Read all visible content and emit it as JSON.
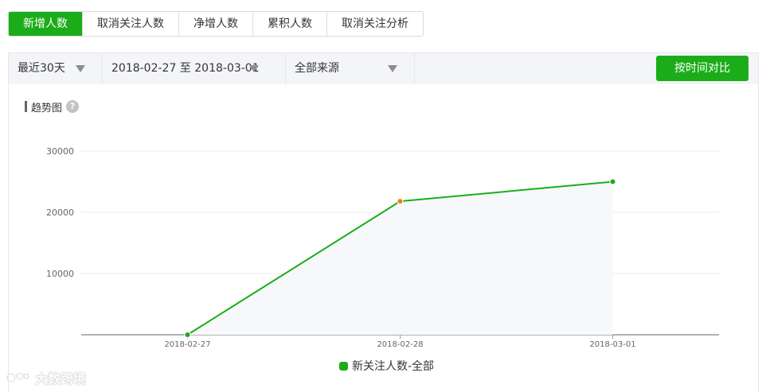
{
  "tabs": [
    {
      "label": "新增人数",
      "active": true
    },
    {
      "label": "取消关注人数",
      "active": false
    },
    {
      "label": "净增人数",
      "active": false
    },
    {
      "label": "累积人数",
      "active": false
    },
    {
      "label": "取消关注分析",
      "active": false
    }
  ],
  "filters": {
    "period": "最近30天",
    "date_range": "2018-02-27 至 2018-03-01",
    "source": "全部来源",
    "compare_button": "按时间对比"
  },
  "panel": {
    "title": "趋势图",
    "help_glyph": "?"
  },
  "watermark": {
    "text": "大数跨境"
  },
  "colors": {
    "accent": "#1aad19",
    "highlight_point": "#f08200",
    "area_fill": "#f7f8fb"
  },
  "chart_data": {
    "type": "line",
    "categories": [
      "2018-02-27",
      "2018-02-28",
      "2018-03-01"
    ],
    "series": [
      {
        "name": "新关注人数-全部",
        "values": [
          0,
          21800,
          25000
        ]
      }
    ],
    "y_ticks": [
      10000,
      20000,
      30000
    ],
    "ylim": [
      0,
      30000
    ],
    "highlighted_index": 1,
    "grid": true,
    "legend_position": "bottom"
  }
}
